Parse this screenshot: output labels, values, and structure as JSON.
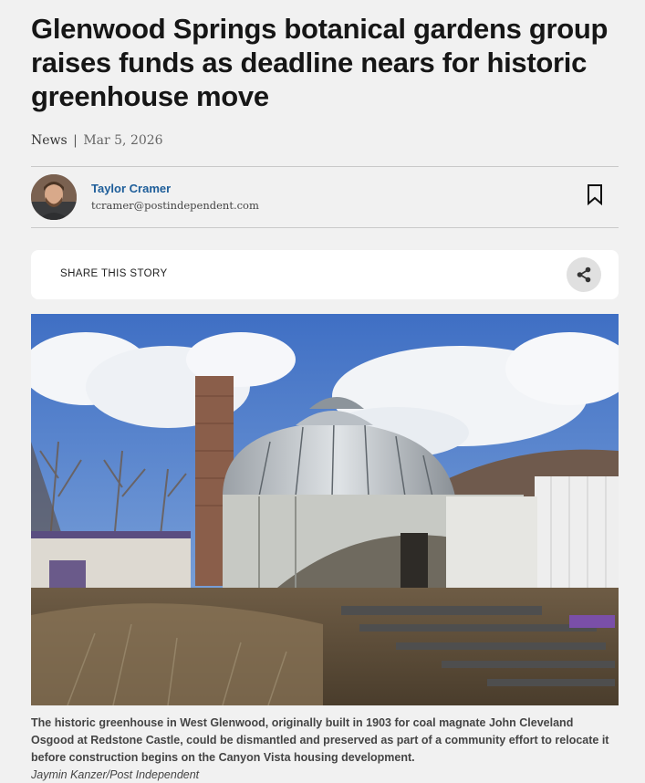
{
  "article": {
    "headline": "Glenwood Springs botanical gardens group raises funds as deadline nears for historic greenhouse move",
    "category": "News",
    "separator": "|",
    "date": "Mar 5, 2026"
  },
  "author": {
    "name": "Taylor Cramer",
    "email": "tcramer@postindependent.com"
  },
  "share": {
    "label": "SHARE THIS STORY"
  },
  "photo": {
    "caption": "The historic greenhouse in West Glenwood, originally built in 1903 for coal magnate John Cleveland Osgood at Redstone Castle, could be dismantled and preserved as part of a community effort to relocate it before construction begins on the Canyon Vista housing development.",
    "credit": "Jaymin Kanzer/Post Independent"
  },
  "icons": {
    "bookmark": "bookmark-icon",
    "share": "share-icon"
  },
  "colors": {
    "author_link": "#1d5d99",
    "background": "#f1f1f1"
  }
}
